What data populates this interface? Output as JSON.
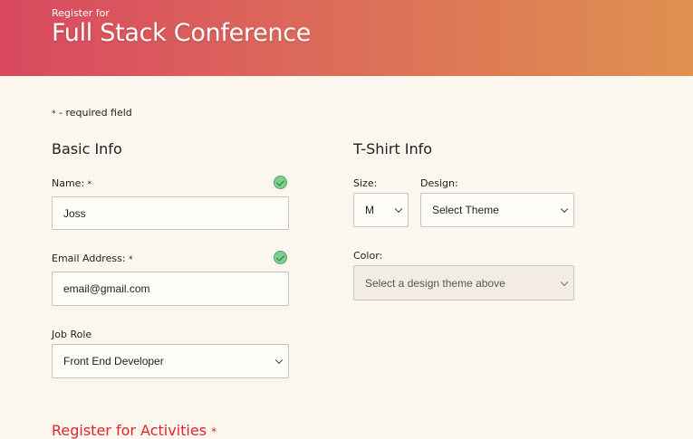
{
  "header": {
    "pretitle": "Register for",
    "title": "Full Stack Conference",
    "gradient_start": "#d9485f",
    "gradient_end": "#df9150"
  },
  "required_note": {
    "star": "*",
    "text": " - required field"
  },
  "basic_info": {
    "title": "Basic Info",
    "name": {
      "label": "Name: ",
      "star": "*",
      "value": "Joss",
      "valid": true
    },
    "email": {
      "label": "Email Address: ",
      "star": "*",
      "value": "email@gmail.com",
      "valid": true
    },
    "job_role": {
      "label": "Job Role",
      "value": "Front End Developer"
    }
  },
  "tshirt_info": {
    "title": "T-Shirt Info",
    "size": {
      "label": "Size:",
      "value": "M"
    },
    "design": {
      "label": "Design:",
      "value": "Select Theme"
    },
    "color": {
      "label": "Color:",
      "value": "Select a design theme above",
      "disabled": true
    }
  },
  "activities": {
    "title": "Register for Activities ",
    "star": "*",
    "color": "#e0242c"
  },
  "icons": {
    "valid_check": "check-circle-icon",
    "dropdown": "chevron-down-icon"
  }
}
